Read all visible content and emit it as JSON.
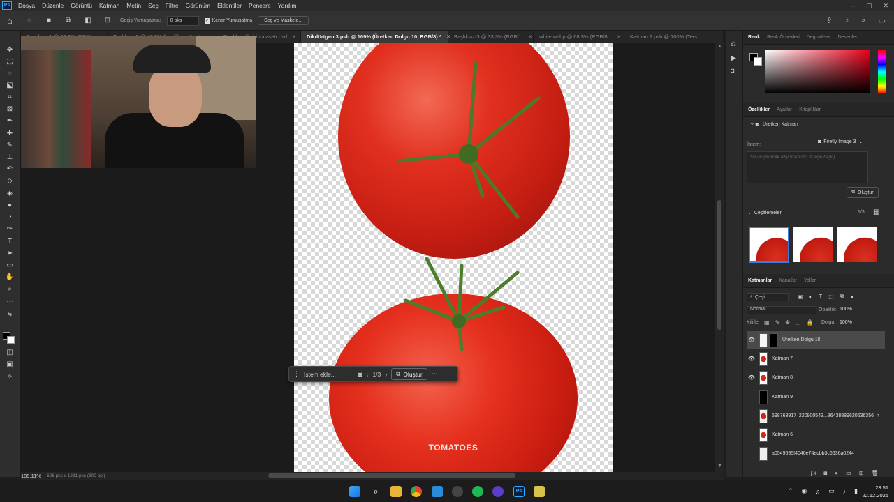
{
  "menu": {
    "logo": "Ps",
    "items": [
      "Dosya",
      "Düzenle",
      "Görüntü",
      "Katman",
      "Metin",
      "Seç",
      "Filtre",
      "Görünüm",
      "Eklentiler",
      "Pencere",
      "Yardım"
    ],
    "window_controls": [
      "–",
      "▢",
      "✕"
    ]
  },
  "options": {
    "feather_label": "Geçiş Yumuşatma:",
    "feather_value": "0 pks",
    "antialias_label": "Kenar Yumuşatma",
    "select_mask_label": "Seç ve Maskele..."
  },
  "tabs": [
    {
      "label": "Başlıksız-1 @ 46,2% (RGB/...",
      "active": false
    },
    {
      "label": "Başlıksız-2 @ 48,3% (kedilili...",
      "active": false
    },
    {
      "label": "Lansman_Renkler_@visioncasetr.psd",
      "active": false
    },
    {
      "label": "Dikdörtgen 3.psb @ 109% (Üretken Dolgu 10, RGB/8) *",
      "active": true
    },
    {
      "label": "Başlıksız-3 @ 33,3% (RGB/...",
      "active": false
    },
    {
      "label": "white.webp @ 68,3% (RGB/8...",
      "active": false
    },
    {
      "label": "Katman 2.psb @ 100% (Ters...",
      "active": false
    }
  ],
  "canvas": {
    "label_text": "TOMATOES"
  },
  "contextbar": {
    "prompt_placeholder": "İstem ekle...",
    "counter": "1/3",
    "generate_label": "Oluştur"
  },
  "status": {
    "zoom": "109.11%",
    "doc_info": "626 pks x 1231 pks (300 ppi)"
  },
  "color_panel": {
    "tabs": [
      "Renk",
      "Renk Örnekleri",
      "Degradeler",
      "Desenler"
    ]
  },
  "props_panel": {
    "tabs": [
      "Özellikler",
      "Ayarlar",
      "Kitaplıklar"
    ],
    "layer_type": "Üretken Katman",
    "prompt_label": "İstem:",
    "model": "Firefly Image 3",
    "prompt_placeholder": "Ne oluşturmak istiyorsunuz? (İsteğe bağlı)",
    "generate_label": "Oluştur",
    "variations_label": "Çeşitlemeler",
    "variations_counter": "1/3"
  },
  "layers_panel": {
    "tabs": [
      "Katmanlar",
      "Kanallar",
      "Yollar"
    ],
    "filter_label": "Çeşit",
    "blend_mode": "Normal",
    "opacity_label": "Opaklık:",
    "opacity_value": "100%",
    "lock_label": "Kilitle:",
    "fill_label": "Dolgu:",
    "fill_value": "100%",
    "layers": [
      {
        "name": "Üretken Dolgu 10",
        "visible": true,
        "selected": true
      },
      {
        "name": "Katman 7",
        "visible": true,
        "selected": false
      },
      {
        "name": "Katman 8",
        "visible": true,
        "selected": false
      },
      {
        "name": "Katman 9",
        "visible": false,
        "selected": false
      },
      {
        "name": "598763917_220900543...86438889620636356_n",
        "visible": false,
        "selected": false
      },
      {
        "name": "Katman 6",
        "visible": false,
        "selected": false
      },
      {
        "name": "a0549695f4046e74ecbb3c6636a0244",
        "visible": false,
        "selected": false
      }
    ]
  },
  "taskbar": {
    "time": "23:51",
    "date": "22.12.2025"
  },
  "colors": {
    "accent": "#31a8ff",
    "tomato": "#d9281c"
  }
}
